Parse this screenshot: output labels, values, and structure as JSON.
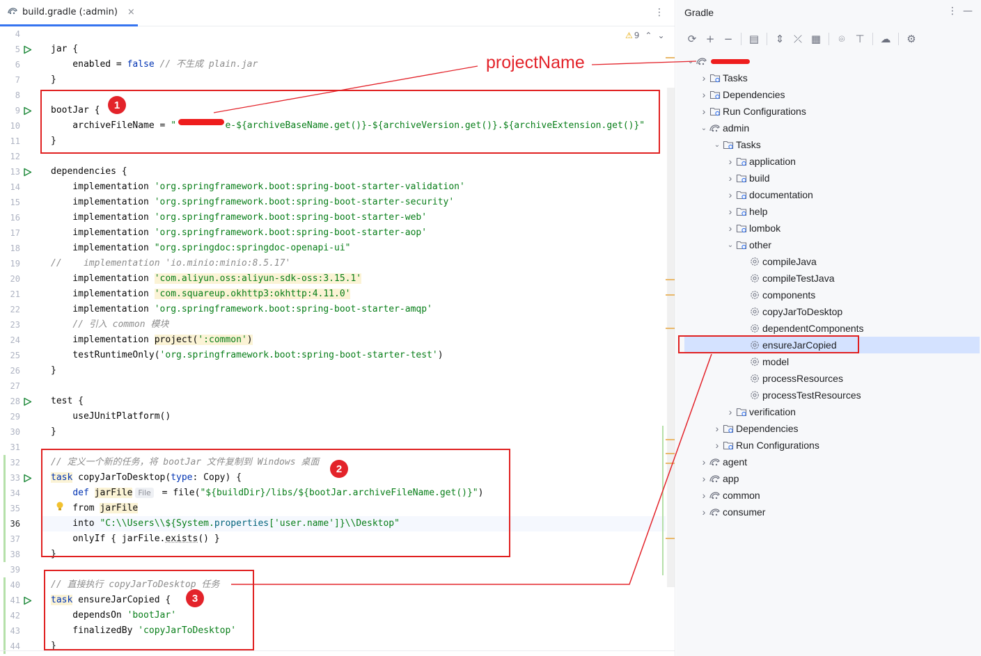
{
  "editor": {
    "tab_title": "build.gradle (:admin)",
    "tab_close": "×",
    "menu_glyph": "⋮",
    "warnings_count": "9",
    "warn_glyph": "⚠",
    "up_glyph": "⌃",
    "down_glyph": "⌄",
    "lines": [
      {
        "n": "4"
      },
      {
        "n": "5",
        "run": true,
        "parts": [
          [
            "jar {",
            ""
          ]
        ]
      },
      {
        "n": "6",
        "parts": [
          [
            "    enabled = ",
            ""
          ],
          [
            "false",
            "kw"
          ],
          [
            " ",
            ""
          ],
          [
            "// 不生成 plain.jar",
            "cm"
          ]
        ]
      },
      {
        "n": "7",
        "parts": [
          [
            "}",
            ""
          ]
        ]
      },
      {
        "n": "8"
      },
      {
        "n": "9",
        "run": true,
        "parts": [
          [
            "bootJar {",
            ""
          ]
        ]
      },
      {
        "n": "10",
        "parts": [
          [
            "    archiveFileName = ",
            ""
          ],
          [
            "\"",
            "str"
          ],
          [
            "         ",
            "str"
          ],
          [
            "e-${archiveBaseName.get()}-${archiveVersion.get()}.${archiveExtension.get()}\"",
            "str"
          ]
        ]
      },
      {
        "n": "11",
        "parts": [
          [
            "}",
            ""
          ]
        ]
      },
      {
        "n": "12"
      },
      {
        "n": "13",
        "run": true,
        "parts": [
          [
            "dependencies {",
            ""
          ]
        ]
      },
      {
        "n": "14",
        "parts": [
          [
            "    implementation ",
            ""
          ],
          [
            "'org.springframework.boot:spring-boot-starter-validation'",
            "str"
          ]
        ]
      },
      {
        "n": "15",
        "parts": [
          [
            "    implementation ",
            ""
          ],
          [
            "'org.springframework.boot:spring-boot-starter-security'",
            "str"
          ]
        ]
      },
      {
        "n": "16",
        "parts": [
          [
            "    implementation ",
            ""
          ],
          [
            "'org.springframework.boot:spring-boot-starter-web'",
            "str"
          ]
        ]
      },
      {
        "n": "17",
        "parts": [
          [
            "    implementation ",
            ""
          ],
          [
            "'org.springframework.boot:spring-boot-starter-aop'",
            "str"
          ]
        ]
      },
      {
        "n": "18",
        "parts": [
          [
            "    implementation ",
            ""
          ],
          [
            "\"org.springdoc:springdoc-openapi-ui\"",
            "str"
          ]
        ]
      },
      {
        "n": "19",
        "parts": [
          [
            "//    implementation 'io.minio:minio:8.5.17'",
            "cm"
          ]
        ]
      },
      {
        "n": "20",
        "parts": [
          [
            "    implementation ",
            ""
          ],
          [
            "'com.aliyun.oss:aliyun-sdk-oss:3.15.1'",
            "str hl"
          ]
        ]
      },
      {
        "n": "21",
        "parts": [
          [
            "    implementation ",
            ""
          ],
          [
            "'com.squareup.okhttp3:okhttp:4.11.0'",
            "str hl"
          ]
        ]
      },
      {
        "n": "22",
        "parts": [
          [
            "    implementation ",
            ""
          ],
          [
            "'org.springframework.boot:spring-boot-starter-amqp'",
            "str"
          ]
        ]
      },
      {
        "n": "23",
        "parts": [
          [
            "    ",
            ""
          ],
          [
            "// 引入 common 模块",
            "cm"
          ]
        ]
      },
      {
        "n": "24",
        "parts": [
          [
            "    implementation ",
            ""
          ],
          [
            "project(",
            "hl"
          ],
          [
            "':common'",
            "str hl"
          ],
          [
            ")",
            "hl"
          ]
        ]
      },
      {
        "n": "25",
        "parts": [
          [
            "    testRuntimeOnly(",
            ""
          ],
          [
            "'org.springframework.boot:spring-boot-starter-test'",
            "str"
          ],
          [
            ")",
            ""
          ]
        ]
      },
      {
        "n": "26",
        "parts": [
          [
            "}",
            ""
          ]
        ]
      },
      {
        "n": "27"
      },
      {
        "n": "28",
        "run": true,
        "parts": [
          [
            "test {",
            ""
          ]
        ]
      },
      {
        "n": "29",
        "parts": [
          [
            "    useJUnitPlatform()",
            ""
          ]
        ]
      },
      {
        "n": "30",
        "parts": [
          [
            "}",
            ""
          ]
        ]
      },
      {
        "n": "31"
      },
      {
        "n": "32",
        "parts": [
          [
            "// 定义一个新的任务，将 bootJar 文件复制到 Windows 桌面",
            "cm"
          ]
        ]
      },
      {
        "n": "33",
        "run": true,
        "parts": [
          [
            "task",
            "kw hl"
          ],
          [
            " copyJarToDesktop(",
            ""
          ],
          [
            "type",
            "kw"
          ],
          [
            ": Copy) {",
            ""
          ]
        ]
      },
      {
        "n": "34",
        "parts": [
          [
            "    ",
            ""
          ],
          [
            "def",
            "kw"
          ],
          [
            " ",
            ""
          ],
          [
            "jarFile",
            "hl"
          ],
          [
            "File",
            "hint"
          ],
          [
            " = file(",
            ""
          ],
          [
            "\"${buildDir}/libs/${bootJar.archiveFileName.get()}\"",
            "str"
          ],
          [
            ")",
            ""
          ]
        ]
      },
      {
        "n": "35",
        "bulb": true,
        "parts": [
          [
            "    from ",
            ""
          ],
          [
            "jarFile",
            "hl"
          ]
        ]
      },
      {
        "n": "36",
        "caret": true,
        "parts": [
          [
            "    into ",
            ""
          ],
          [
            "\"C:\\\\Users\\\\${System.",
            "str"
          ],
          [
            "properties",
            "fn"
          ],
          [
            "[",
            "str"
          ],
          [
            "'user.name'",
            "str"
          ],
          [
            "]}\\\\Desktop\"",
            "str"
          ]
        ]
      },
      {
        "n": "37",
        "parts": [
          [
            "    onlyIf { jarFile.",
            ""
          ],
          [
            "exists",
            "under"
          ],
          [
            "() }",
            ""
          ]
        ]
      },
      {
        "n": "38",
        "parts": [
          [
            "}",
            ""
          ]
        ]
      },
      {
        "n": "39"
      },
      {
        "n": "40",
        "parts": [
          [
            "// 直接执行 copyJarToDesktop 任务",
            "cm"
          ]
        ]
      },
      {
        "n": "41",
        "run": true,
        "parts": [
          [
            "task",
            "kw hl"
          ],
          [
            " ensureJarCopied {",
            ""
          ]
        ]
      },
      {
        "n": "42",
        "parts": [
          [
            "    dependsOn ",
            ""
          ],
          [
            "'bootJar'",
            "str"
          ]
        ]
      },
      {
        "n": "43",
        "parts": [
          [
            "    finalizedBy ",
            ""
          ],
          [
            "'copyJarToDesktop'",
            "str"
          ]
        ]
      },
      {
        "n": "44",
        "parts": [
          [
            "}",
            ""
          ]
        ]
      }
    ]
  },
  "gradle": {
    "title": "Gradle",
    "more_glyph": "⋮",
    "minimize_glyph": "—",
    "toolbar": [
      {
        "icon": "refresh-icon",
        "glyph": "⟳"
      },
      {
        "icon": "add-icon",
        "glyph": "+"
      },
      {
        "icon": "remove-icon",
        "glyph": "−"
      },
      {
        "sep": true
      },
      {
        "icon": "execute-task-icon",
        "glyph": "▤"
      },
      {
        "sep": true
      },
      {
        "icon": "expand-all-icon",
        "glyph": "⇕"
      },
      {
        "icon": "collapse-all-icon",
        "glyph": "⤫"
      },
      {
        "icon": "analyze-deps-icon",
        "glyph": "▦"
      },
      {
        "sep": true
      },
      {
        "icon": "toggle-offline-icon",
        "glyph": "⌾"
      },
      {
        "icon": "show-task-icon",
        "glyph": "⊤"
      },
      {
        "sep": true
      },
      {
        "icon": "offline-mode-icon",
        "glyph": "☁"
      },
      {
        "sep": true
      },
      {
        "icon": "settings-icon",
        "glyph": "⚙"
      }
    ],
    "tree": [
      {
        "label": "",
        "depth": 0,
        "chev": "open",
        "icon": "gradle",
        "redacted": true
      },
      {
        "label": "Tasks",
        "depth": 1,
        "chev": "closed",
        "icon": "folder"
      },
      {
        "label": "Dependencies",
        "depth": 1,
        "chev": "closed",
        "icon": "folder"
      },
      {
        "label": "Run Configurations",
        "depth": 1,
        "chev": "closed",
        "icon": "folder"
      },
      {
        "label": "admin",
        "depth": 1,
        "chev": "open",
        "icon": "gradle"
      },
      {
        "label": "Tasks",
        "depth": 2,
        "chev": "open",
        "icon": "folder"
      },
      {
        "label": "application",
        "depth": 3,
        "chev": "closed",
        "icon": "folder"
      },
      {
        "label": "build",
        "depth": 3,
        "chev": "closed",
        "icon": "folder"
      },
      {
        "label": "documentation",
        "depth": 3,
        "chev": "closed",
        "icon": "folder"
      },
      {
        "label": "help",
        "depth": 3,
        "chev": "closed",
        "icon": "folder"
      },
      {
        "label": "lombok",
        "depth": 3,
        "chev": "closed",
        "icon": "folder"
      },
      {
        "label": "other",
        "depth": 3,
        "chev": "open",
        "icon": "folder"
      },
      {
        "label": "compileJava",
        "depth": 4,
        "chev": "none",
        "icon": "gear"
      },
      {
        "label": "compileTestJava",
        "depth": 4,
        "chev": "none",
        "icon": "gear"
      },
      {
        "label": "components",
        "depth": 4,
        "chev": "none",
        "icon": "gear"
      },
      {
        "label": "copyJarToDesktop",
        "depth": 4,
        "chev": "none",
        "icon": "gear"
      },
      {
        "label": "dependentComponents",
        "depth": 4,
        "chev": "none",
        "icon": "gear"
      },
      {
        "label": "ensureJarCopied",
        "depth": 4,
        "chev": "none",
        "icon": "gear",
        "selected": true
      },
      {
        "label": "model",
        "depth": 4,
        "chev": "none",
        "icon": "gear"
      },
      {
        "label": "processResources",
        "depth": 4,
        "chev": "none",
        "icon": "gear"
      },
      {
        "label": "processTestResources",
        "depth": 4,
        "chev": "none",
        "icon": "gear"
      },
      {
        "label": "verification",
        "depth": 3,
        "chev": "closed",
        "icon": "folder"
      },
      {
        "label": "Dependencies",
        "depth": 2,
        "chev": "closed",
        "icon": "folder"
      },
      {
        "label": "Run Configurations",
        "depth": 2,
        "chev": "closed",
        "icon": "folder"
      },
      {
        "label": "agent",
        "depth": 1,
        "chev": "closed",
        "icon": "gradle"
      },
      {
        "label": "app",
        "depth": 1,
        "chev": "closed",
        "icon": "gradle"
      },
      {
        "label": "common",
        "depth": 1,
        "chev": "closed",
        "icon": "gradle"
      },
      {
        "label": "consumer",
        "depth": 1,
        "chev": "closed",
        "icon": "gradle"
      }
    ]
  },
  "annotations": {
    "label": "projectName",
    "badges": [
      "1",
      "2",
      "3"
    ],
    "color": "#e3232a"
  }
}
